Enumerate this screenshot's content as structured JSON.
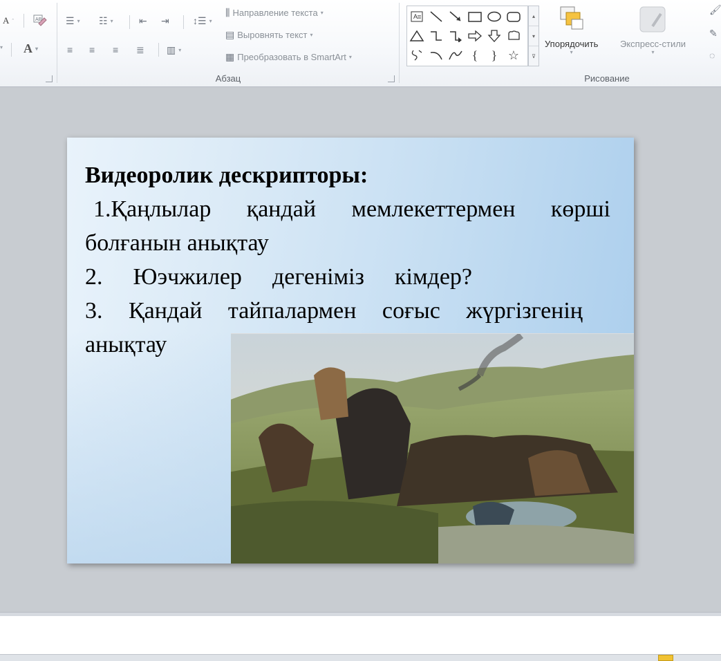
{
  "ribbon": {
    "font_group": {
      "grow_font_label": "A",
      "font_color_label": "A"
    },
    "paragraph_group": {
      "label": "Абзац",
      "text_direction_label": "Направление текста",
      "align_text_label": "Выровнять текст",
      "smartart_label": "Преобразовать в SmartArt"
    },
    "drawing_group": {
      "label": "Рисование",
      "arrange_label": "Упорядочить",
      "quick_styles_label": "Экспресс-стили"
    },
    "shapes": [
      "text-box",
      "line",
      "arrow",
      "rectangle",
      "oval",
      "rounded-rectangle",
      "triangle",
      "elbow-connector",
      "elbow-arrow",
      "right-arrow",
      "down-arrow",
      "callout",
      "freeform",
      "arc",
      "curve",
      "left-brace",
      "right-brace",
      "star"
    ]
  },
  "slide": {
    "title": "Видеоролик дескрипторы:",
    "item1_line1": "1.Қаңлылар қандай мемлекеттермен көрші",
    "item1_line2": "болғанын анықтау",
    "item2": "2. Юэчжилер дегеніміз кімдер?",
    "item3_line1": "3. Қандай тайпалармен соғыс жүргізгенің",
    "item3_line2": "анықтау"
  },
  "colors": {
    "slide_gradient_start": "#e9f3fb",
    "slide_gradient_end": "#a9cdec",
    "ribbon_text": "#8a9097"
  }
}
